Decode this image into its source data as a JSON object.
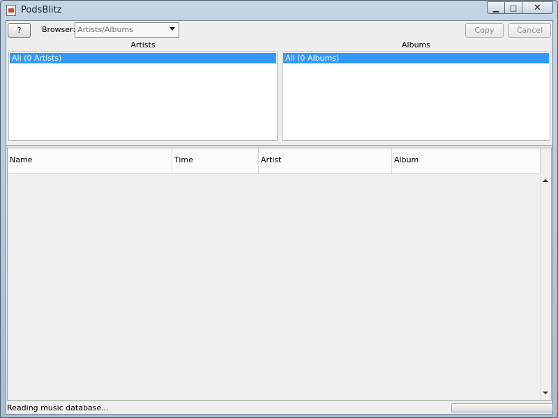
{
  "window": {
    "title": "PodsBlitz",
    "minimize_glyph": "▁",
    "maximize_glyph": "□",
    "close_glyph": "✕"
  },
  "toolbar": {
    "help_label": "?",
    "browser_label": "Browser:",
    "browser_value": "Artists/Albums",
    "copy_label": "Copy",
    "cancel_label": "Cancel"
  },
  "browser": {
    "artists": {
      "header": "Artists",
      "items": [
        "All (0 Artists)"
      ]
    },
    "albums": {
      "header": "Albums",
      "items": [
        "All (0 Albums)"
      ]
    }
  },
  "table": {
    "columns": [
      "Name",
      "Time",
      "Artist",
      "Album"
    ],
    "rows": []
  },
  "status": {
    "text": "Reading music database...",
    "progress_fraction": 0.0
  },
  "colors": {
    "selection": "#3399ff",
    "window_frame": "#b9c6d4",
    "panel_bg": "#eeeeee"
  },
  "icons": {
    "app": "app-icon",
    "dropdown": "chevron-down-icon"
  }
}
